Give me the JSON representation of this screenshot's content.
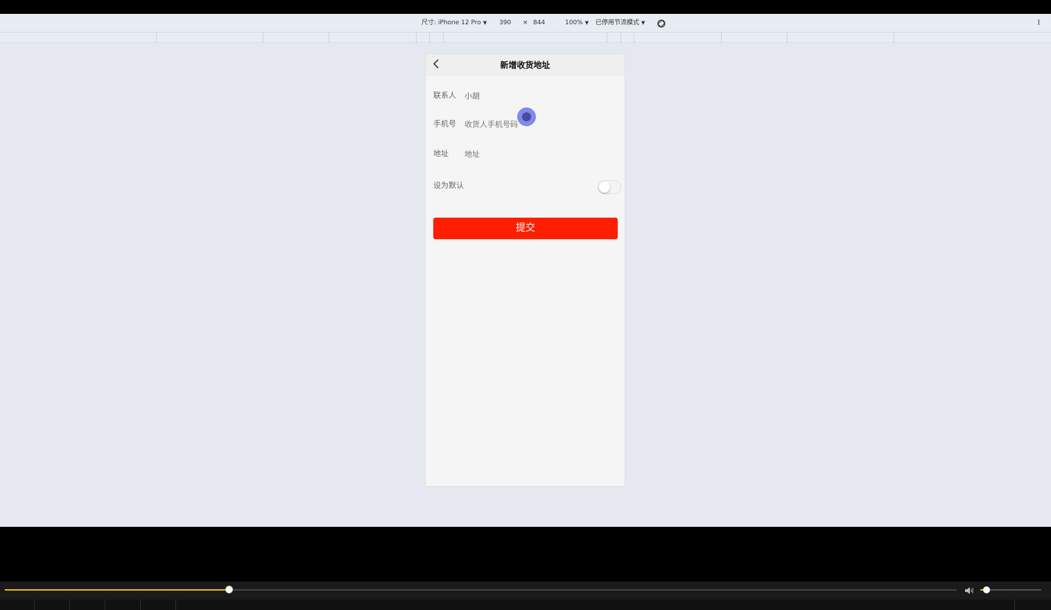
{
  "devtools": {
    "size_label": "尺寸: iPhone 12 Pro",
    "width": "390",
    "times": "×",
    "height": "844",
    "zoom": "100%",
    "throttle": "已停用节流模式"
  },
  "page": {
    "title": "新增收货地址",
    "fields": [
      {
        "label": "联系人",
        "value": "小胡",
        "placeholder": ""
      },
      {
        "label": "手机号",
        "value": "",
        "placeholder": "收货人手机号码"
      },
      {
        "label": "地址",
        "value": "",
        "placeholder": "地址"
      }
    ],
    "default_label": "设为默认",
    "default_on": false,
    "submit_label": "提交"
  },
  "player": {
    "progress": 0.235,
    "volume": 0.1
  },
  "colors": {
    "accent": "#fe1f00",
    "progress": "#f2c200"
  }
}
